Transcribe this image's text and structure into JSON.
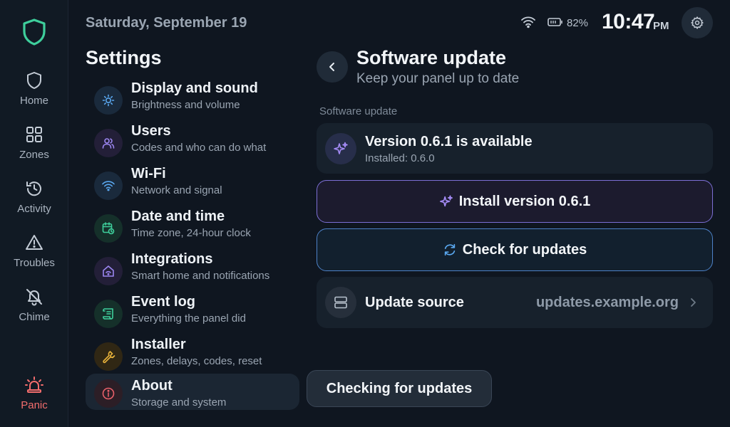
{
  "nav": {
    "items": [
      {
        "label": "Home",
        "icon": "shield-icon"
      },
      {
        "label": "Zones",
        "icon": "grid-icon"
      },
      {
        "label": "Activity",
        "icon": "history-icon"
      },
      {
        "label": "Troubles",
        "icon": "warning-icon"
      },
      {
        "label": "Chime",
        "icon": "bell-off-icon"
      }
    ],
    "panic_label": "Panic",
    "panic_color": "#f26d6d",
    "logo_color": "#3ecf9c"
  },
  "header": {
    "date": "Saturday, September 19",
    "battery": "82%",
    "time": "10:47",
    "ampm": "PM"
  },
  "settings": {
    "title": "Settings",
    "items": [
      {
        "title": "Display and sound",
        "desc": "Brightness and volume",
        "icon": "sun-icon"
      },
      {
        "title": "Users",
        "desc": "Codes and who can do what",
        "icon": "users-icon"
      },
      {
        "title": "Wi-Fi",
        "desc": "Network and signal",
        "icon": "wifi-icon"
      },
      {
        "title": "Date and time",
        "desc": "Time zone, 24-hour clock",
        "icon": "calendar-clock-icon"
      },
      {
        "title": "Integrations",
        "desc": "Smart home and notifications",
        "icon": "smart-home-icon"
      },
      {
        "title": "Event log",
        "desc": "Everything the panel did",
        "icon": "scroll-icon"
      },
      {
        "title": "Installer",
        "desc": "Zones, delays, codes, reset",
        "icon": "wrench-icon"
      },
      {
        "title": "About",
        "desc": "Storage and system",
        "icon": "info-icon"
      }
    ],
    "active_index": 7
  },
  "panel": {
    "title": "Software update",
    "subtitle": "Keep your panel up to date",
    "section": "Software update",
    "version_title": "Version 0.6.1 is available",
    "version_installed": "Installed: 0.6.0",
    "install_label": "Install version 0.6.1",
    "check_label": "Check for updates",
    "source_label": "Update source",
    "source_value": "updates.example.org"
  },
  "toast": "Checking for updates"
}
